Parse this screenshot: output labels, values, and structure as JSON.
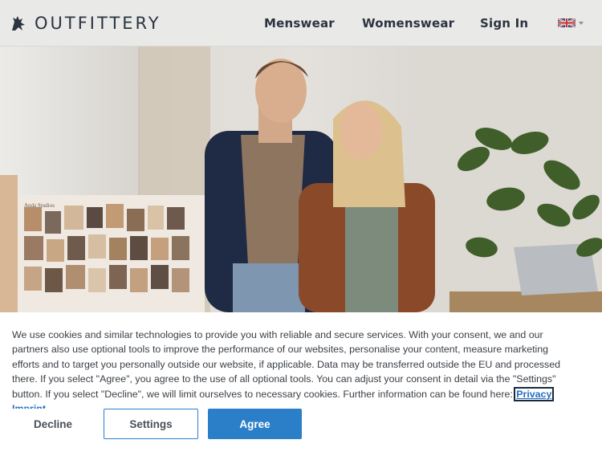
{
  "header": {
    "brand": "OUTFITTERY",
    "nav": {
      "menswear": "Menswear",
      "womenswear": "Womenswear",
      "sign_in": "Sign In"
    },
    "language_icon": "uk-flag-icon"
  },
  "hero": {
    "image": "hero-couple-photo",
    "moodboard_label": "Anda Studios"
  },
  "cookie": {
    "text": "We use cookies and similar technologies to provide you with reliable and secure services. With your consent, we and our partners also use optional tools to improve the performance of our websites, personalise your content, measure marketing efforts and to target you personally outside our website, if applicable. Data may be transferred outside the EU and processed there. If you select \"Agree\", you agree to the use of all optional tools. You can adjust your consent in detail via the \"Settings\" button. If you select \"Decline\", we will limit ourselves to necessary cookies. Further information can be found here: ",
    "privacy_link": "Privacy",
    "imprint_link": "Imprint",
    "decline_label": "Decline",
    "settings_label": "Settings",
    "agree_label": "Agree"
  },
  "colors": {
    "brand_dark": "#2b3440",
    "accent_blue": "#2b7fc9",
    "header_bg": "#e9e9e8"
  }
}
